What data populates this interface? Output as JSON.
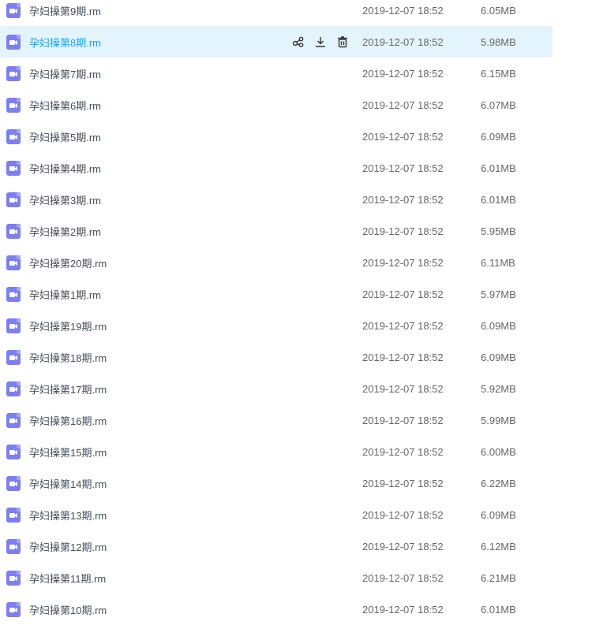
{
  "files": [
    {
      "name": "孕妇操第9期.rm",
      "date": "2019-12-07 18:52",
      "size": "6.05MB"
    },
    {
      "name": "孕妇操第8期.rm",
      "date": "2019-12-07 18:52",
      "size": "5.98MB",
      "hovered": true
    },
    {
      "name": "孕妇操第7期.rm",
      "date": "2019-12-07 18:52",
      "size": "6.15MB"
    },
    {
      "name": "孕妇操第6期.rm",
      "date": "2019-12-07 18:52",
      "size": "6.07MB"
    },
    {
      "name": "孕妇操第5期.rm",
      "date": "2019-12-07 18:52",
      "size": "6.09MB"
    },
    {
      "name": "孕妇操第4期.rm",
      "date": "2019-12-07 18:52",
      "size": "6.01MB"
    },
    {
      "name": "孕妇操第3期.rm",
      "date": "2019-12-07 18:52",
      "size": "6.01MB"
    },
    {
      "name": "孕妇操第2期.rm",
      "date": "2019-12-07 18:52",
      "size": "5.95MB"
    },
    {
      "name": "孕妇操第20期.rm",
      "date": "2019-12-07 18:52",
      "size": "6.11MB"
    },
    {
      "name": "孕妇操第1期.rm",
      "date": "2019-12-07 18:52",
      "size": "5.97MB"
    },
    {
      "name": "孕妇操第19期.rm",
      "date": "2019-12-07 18:52",
      "size": "6.09MB"
    },
    {
      "name": "孕妇操第18期.rm",
      "date": "2019-12-07 18:52",
      "size": "6.09MB"
    },
    {
      "name": "孕妇操第17期.rm",
      "date": "2019-12-07 18:52",
      "size": "5.92MB"
    },
    {
      "name": "孕妇操第16期.rm",
      "date": "2019-12-07 18:52",
      "size": "5.99MB"
    },
    {
      "name": "孕妇操第15期.rm",
      "date": "2019-12-07 18:52",
      "size": "6.00MB"
    },
    {
      "name": "孕妇操第14期.rm",
      "date": "2019-12-07 18:52",
      "size": "6.22MB"
    },
    {
      "name": "孕妇操第13期.rm",
      "date": "2019-12-07 18:52",
      "size": "6.09MB"
    },
    {
      "name": "孕妇操第12期.rm",
      "date": "2019-12-07 18:52",
      "size": "6.12MB"
    },
    {
      "name": "孕妇操第11期.rm",
      "date": "2019-12-07 18:52",
      "size": "6.21MB"
    },
    {
      "name": "孕妇操第10期.rm",
      "date": "2019-12-07 18:52",
      "size": "6.01MB"
    }
  ],
  "file_icon": "video-file-icon",
  "row_actions": [
    "share-icon",
    "download-icon",
    "delete-icon"
  ],
  "colors": {
    "hover_bg": "#e3f4fd",
    "hover_text": "#09aaff",
    "icon": "#7b7ff2"
  }
}
